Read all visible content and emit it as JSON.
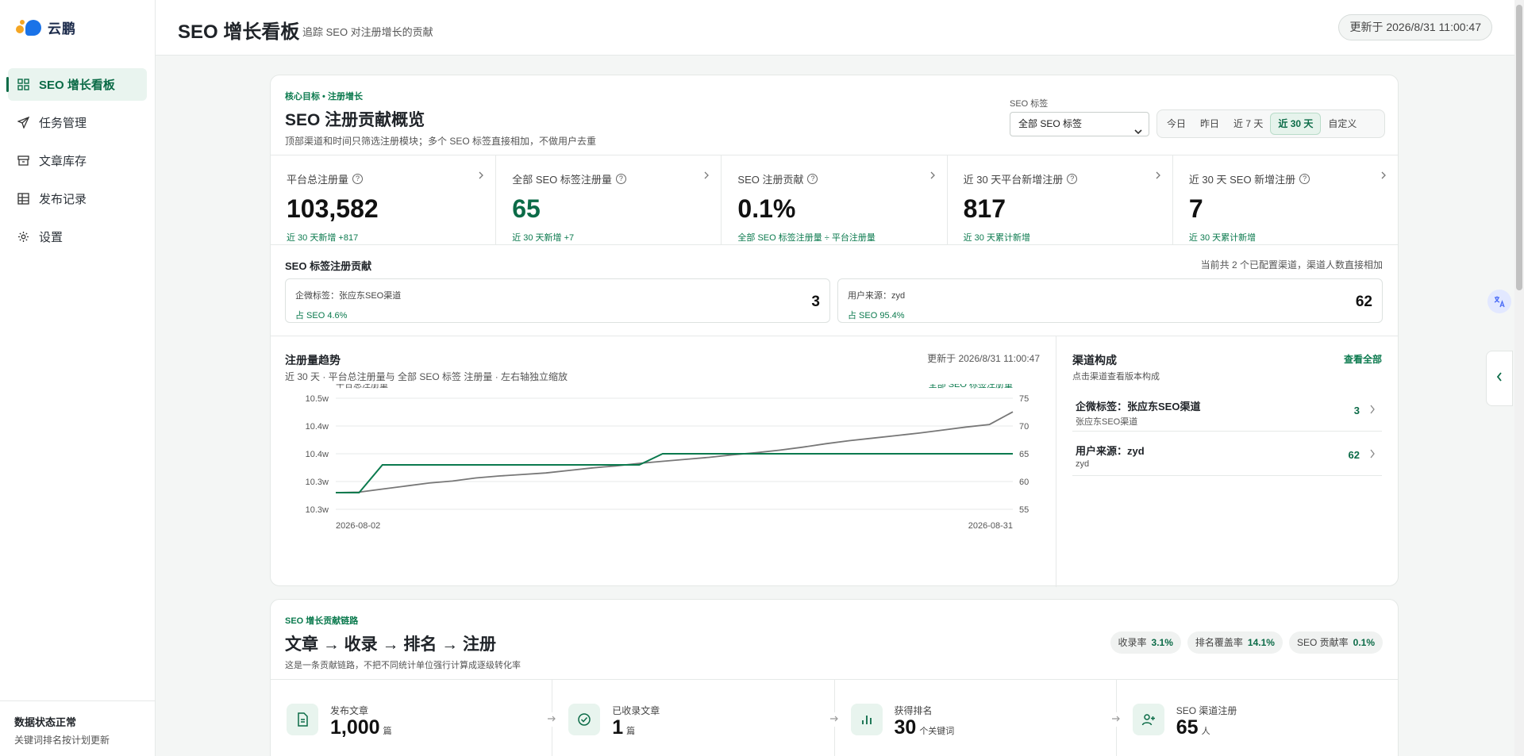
{
  "app": {
    "logo_text": "云鹏"
  },
  "sidebar": {
    "items": [
      {
        "label": "SEO 增长看板",
        "icon": "dashboard-icon",
        "active": true
      },
      {
        "label": "任务管理",
        "icon": "send-icon"
      },
      {
        "label": "文章库存",
        "icon": "archive-icon"
      },
      {
        "label": "发布记录",
        "icon": "table-icon"
      },
      {
        "label": "设置",
        "icon": "gear-icon"
      }
    ],
    "status_title": "数据状态正常",
    "status_sub": "关键词排名按计划更新"
  },
  "header": {
    "title": "SEO 增长看板",
    "subtitle": "追踪 SEO 对注册增长的贡献",
    "updated": "更新于 2026/8/31 11:00:47"
  },
  "overview": {
    "eyebrow": "核心目标 • 注册增长",
    "title": "SEO 注册贡献概览",
    "desc": "顶部渠道和时间只筛选注册模块；多个 SEO 标签直接相加，不做用户去重",
    "seo_tag_label": "SEO 标签",
    "seo_tag_value": "全部 SEO 标签",
    "ranges": [
      {
        "label": "今日",
        "active": false
      },
      {
        "label": "昨日",
        "active": false
      },
      {
        "label": "近 7 天",
        "active": false
      },
      {
        "label": "近 30 天",
        "active": true
      },
      {
        "label": "自定义",
        "active": false
      }
    ]
  },
  "kpis": [
    {
      "label": "平台总注册量",
      "value": "103,582",
      "foot": "近 30 天新增 +817",
      "green": false
    },
    {
      "label": "全部 SEO 标签注册量",
      "value": "65",
      "foot": "近 30 天新增 +7",
      "green": true
    },
    {
      "label": "SEO 注册贡献",
      "value": "0.1%",
      "foot": "全部 SEO 标签注册量 ÷ 平台注册量",
      "green": false
    },
    {
      "label": "近 30 天平台新增注册",
      "value": "817",
      "foot": "近 30 天累计新增",
      "green": false
    },
    {
      "label": "近 30 天 SEO 新增注册",
      "value": "7",
      "foot": "近 30 天累计新增",
      "green": false
    }
  ],
  "contribution": {
    "title": "SEO 标签注册贡献",
    "note": "当前共 2 个已配置渠道，渠道人数直接相加",
    "items": [
      {
        "name": "企微标签：张应东SEO渠道",
        "share": "占 SEO 4.6%",
        "value": "3"
      },
      {
        "name": "用户来源：zyd",
        "share": "占 SEO 95.4%",
        "value": "62"
      }
    ]
  },
  "trend": {
    "title": "注册量趋势",
    "subtitle": "近 30 天 · 平台总注册量与 全部 SEO 标签 注册量 · 左右轴独立缩放",
    "updated": "更新于 2026/8/31 11:00:47"
  },
  "chart_data": {
    "type": "line",
    "title": "注册量趋势",
    "x_start_label": "2026-08-02",
    "x_end_label": "2026-08-31",
    "left_axis": {
      "label": "平台总注册量",
      "ticks": [
        "10.5w",
        "10.4w",
        "10.4w",
        "10.3w",
        "10.3w"
      ],
      "range": [
        102600,
        103700
      ]
    },
    "right_axis": {
      "label": "全部 SEO 标签注册量",
      "ticks": [
        "75",
        "70",
        "65",
        "60",
        "55"
      ],
      "range": [
        55,
        75
      ]
    },
    "series": [
      {
        "name": "平台总注册量",
        "axis": "left",
        "color": "#777777",
        "values": [
          102765,
          102770,
          102800,
          102830,
          102860,
          102880,
          102910,
          102930,
          102945,
          102960,
          102985,
          103010,
          103030,
          103055,
          103075,
          103095,
          103115,
          103140,
          103160,
          103185,
          103215,
          103250,
          103280,
          103305,
          103330,
          103355,
          103385,
          103415,
          103440,
          103565
        ]
      },
      {
        "name": "全部 SEO 标签注册量",
        "axis": "right",
        "color": "#0b7a4e",
        "values": [
          58,
          58,
          63,
          63,
          63,
          63,
          63,
          63,
          63,
          63,
          63,
          63,
          63,
          63,
          65,
          65,
          65,
          65,
          65,
          65,
          65,
          65,
          65,
          65,
          65,
          65,
          65,
          65,
          65,
          65
        ]
      }
    ],
    "grid": true
  },
  "channels": {
    "title": "渠道构成",
    "view_all": "查看全部",
    "subtitle": "点击渠道查看版本构成",
    "items": [
      {
        "name": "企微标签：张应东SEO渠道",
        "sub": "张应东SEO渠道",
        "value": "3"
      },
      {
        "name": "用户来源：zyd",
        "sub": "zyd",
        "value": "62"
      }
    ]
  },
  "funnel": {
    "eyebrow": "SEO 增长贡献链路",
    "title": "文章 → 收录 → 排名 → 注册",
    "desc": "这是一条贡献链路，不把不同统计单位强行计算成逐级转化率",
    "rates": [
      {
        "label": "收录率",
        "value": "3.1%"
      },
      {
        "label": "排名覆盖率",
        "value": "14.1%"
      },
      {
        "label": "SEO 贡献率",
        "value": "0.1%"
      }
    ],
    "steps": [
      {
        "label": "发布文章",
        "value": "1,000",
        "unit": "篇",
        "icon": "document-icon"
      },
      {
        "label": "已收录文章",
        "value": "1",
        "unit": "篇",
        "icon": "check-circle-icon"
      },
      {
        "label": "获得排名",
        "value": "30",
        "unit": "个关键词",
        "icon": "bar-chart-icon"
      },
      {
        "label": "SEO 渠道注册",
        "value": "65",
        "unit": "人",
        "icon": "user-add-icon"
      }
    ]
  },
  "colors": {
    "accent": "#0b6b47",
    "accent_light": "#e9f4ef",
    "line_gray": "#777777"
  }
}
